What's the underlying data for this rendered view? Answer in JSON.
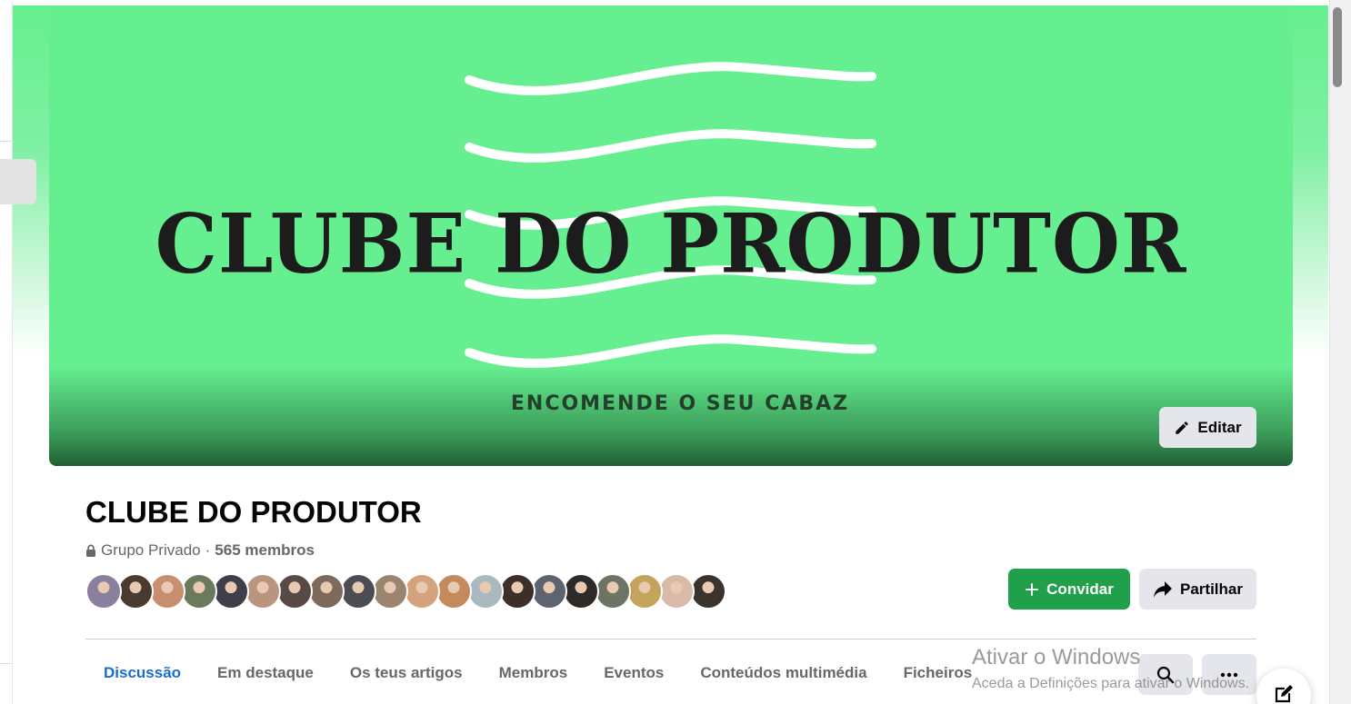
{
  "cover": {
    "title": "CLUBE DO PRODUTOR",
    "subtitle": "ENCOMENDE O SEU CABAZ",
    "edit_label": "Editar",
    "background_color": "#66ef90"
  },
  "group": {
    "name": "CLUBE DO PRODUTOR",
    "privacy": "Grupo Privado",
    "separator": "·",
    "members": "565 membros",
    "avatar_colors": [
      "#8a7f9c",
      "#4a3a30",
      "#c98e6f",
      "#6b7a5c",
      "#3e3f48",
      "#b9957f",
      "#5a4a45",
      "#7d6a5a",
      "#4c4c52",
      "#9c8570",
      "#d4a27d",
      "#c48a5e",
      "#aab8c0",
      "#3d2e2a",
      "#5d6470",
      "#2e2a28",
      "#6e7464",
      "#c4a35c",
      "#d9b9a8",
      "#3a332e"
    ]
  },
  "actions": {
    "invite_label": "Convidar",
    "share_label": "Partilhar",
    "accent": "#20a04a"
  },
  "tabs": [
    {
      "label": "Discussão",
      "active": true
    },
    {
      "label": "Em destaque",
      "active": false
    },
    {
      "label": "Os teus artigos",
      "active": false
    },
    {
      "label": "Membros",
      "active": false
    },
    {
      "label": "Eventos",
      "active": false
    },
    {
      "label": "Conteúdos multimédia",
      "active": false
    },
    {
      "label": "Ficheiros",
      "active": false
    }
  ],
  "icons": {
    "edit": "pencil-icon",
    "lock": "lock-icon",
    "invite": "plus-icon",
    "share": "share-arrow-icon",
    "search": "search-icon",
    "more": "more-icon",
    "compose": "compose-icon"
  },
  "watermark": {
    "line1": "Ativar o Windows",
    "line2": "Aceda a Definições para ativar o Windows."
  }
}
